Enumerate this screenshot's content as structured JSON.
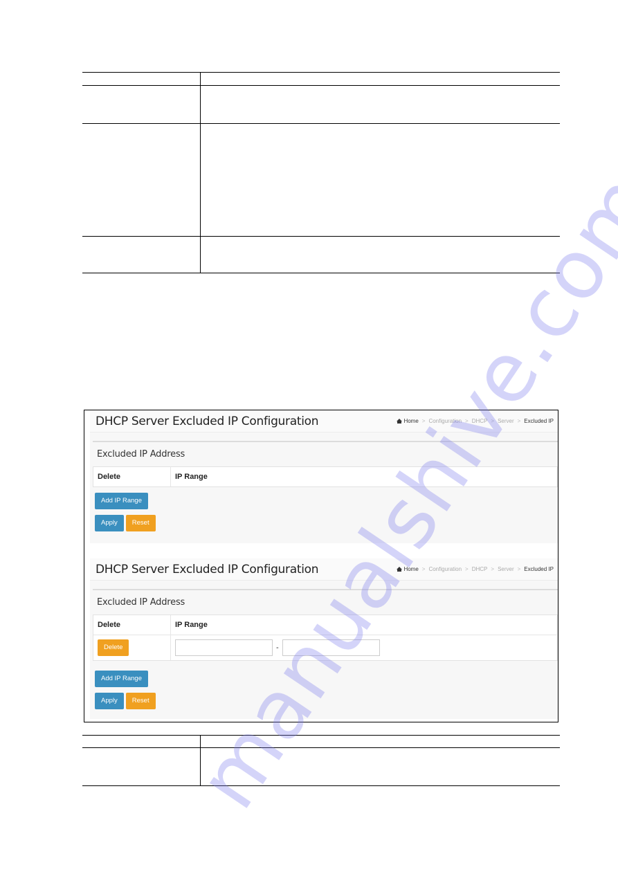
{
  "top_table": {
    "rows": [
      {
        "label": "",
        "description": ""
      },
      {
        "label": "",
        "description": ""
      },
      {
        "label": "",
        "description": ""
      },
      {
        "label": "",
        "description": ""
      }
    ]
  },
  "screenshot_1": {
    "title": "DHCP Server Excluded IP Configuration",
    "breadcrumb": [
      "Home",
      "Configuration",
      "DHCP",
      "Server",
      "Excluded IP"
    ],
    "section_title": "Excluded IP Address",
    "columns": [
      "Delete",
      "IP Range"
    ],
    "rows": [],
    "buttons": {
      "add": "Add IP Range",
      "apply": "Apply",
      "reset": "Reset"
    }
  },
  "screenshot_2": {
    "title": "DHCP Server Excluded IP Configuration",
    "breadcrumb": [
      "Home",
      "Configuration",
      "DHCP",
      "Server",
      "Excluded IP"
    ],
    "section_title": "Excluded IP Address",
    "columns": [
      "Delete",
      "IP Range"
    ],
    "rows": [
      {
        "delete_label": "Delete",
        "range_start": "",
        "range_end": "",
        "separator": "-"
      }
    ],
    "buttons": {
      "add": "Add IP Range",
      "apply": "Apply",
      "reset": "Reset"
    }
  },
  "bottom_table": {
    "rows": [
      {
        "label": "",
        "description": ""
      },
      {
        "label": "",
        "description": ""
      }
    ]
  },
  "watermark": "manualshive.com",
  "colors": {
    "primary_button": "#3a8fbf",
    "warning_button": "#f0a020"
  }
}
